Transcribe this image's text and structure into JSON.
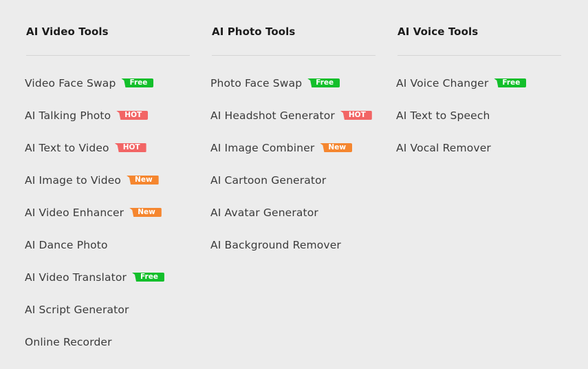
{
  "colors": {
    "background": "#ececec",
    "free_badge": "#13bf2b",
    "hot_badge": "#f26565",
    "new_badge": "#f5862f"
  },
  "columns": [
    {
      "title": "AI Video Tools",
      "items": [
        {
          "label": "Video Face Swap",
          "badge": "Free"
        },
        {
          "label": "AI Talking Photo",
          "badge": "HOT"
        },
        {
          "label": "AI Text to Video",
          "badge": "HOT"
        },
        {
          "label": "AI Image to Video",
          "badge": "New"
        },
        {
          "label": "AI Video Enhancer",
          "badge": "New"
        },
        {
          "label": "AI Dance Photo",
          "badge": null
        },
        {
          "label": "AI Video Translator",
          "badge": "Free"
        },
        {
          "label": "AI Script Generator",
          "badge": null
        },
        {
          "label": "Online Recorder",
          "badge": null
        }
      ]
    },
    {
      "title": "AI Photo Tools",
      "items": [
        {
          "label": "Photo Face Swap",
          "badge": "Free"
        },
        {
          "label": "AI Headshot Generator",
          "badge": "HOT"
        },
        {
          "label": "AI Image Combiner",
          "badge": "New"
        },
        {
          "label": "AI Cartoon Generator",
          "badge": null
        },
        {
          "label": "AI Avatar Generator",
          "badge": null
        },
        {
          "label": "AI Background Remover",
          "badge": null
        }
      ]
    },
    {
      "title": "AI Voice Tools",
      "items": [
        {
          "label": "AI Voice Changer",
          "badge": "Free"
        },
        {
          "label": "AI Text to Speech",
          "badge": null
        },
        {
          "label": "AI Vocal Remover",
          "badge": null
        }
      ]
    }
  ]
}
